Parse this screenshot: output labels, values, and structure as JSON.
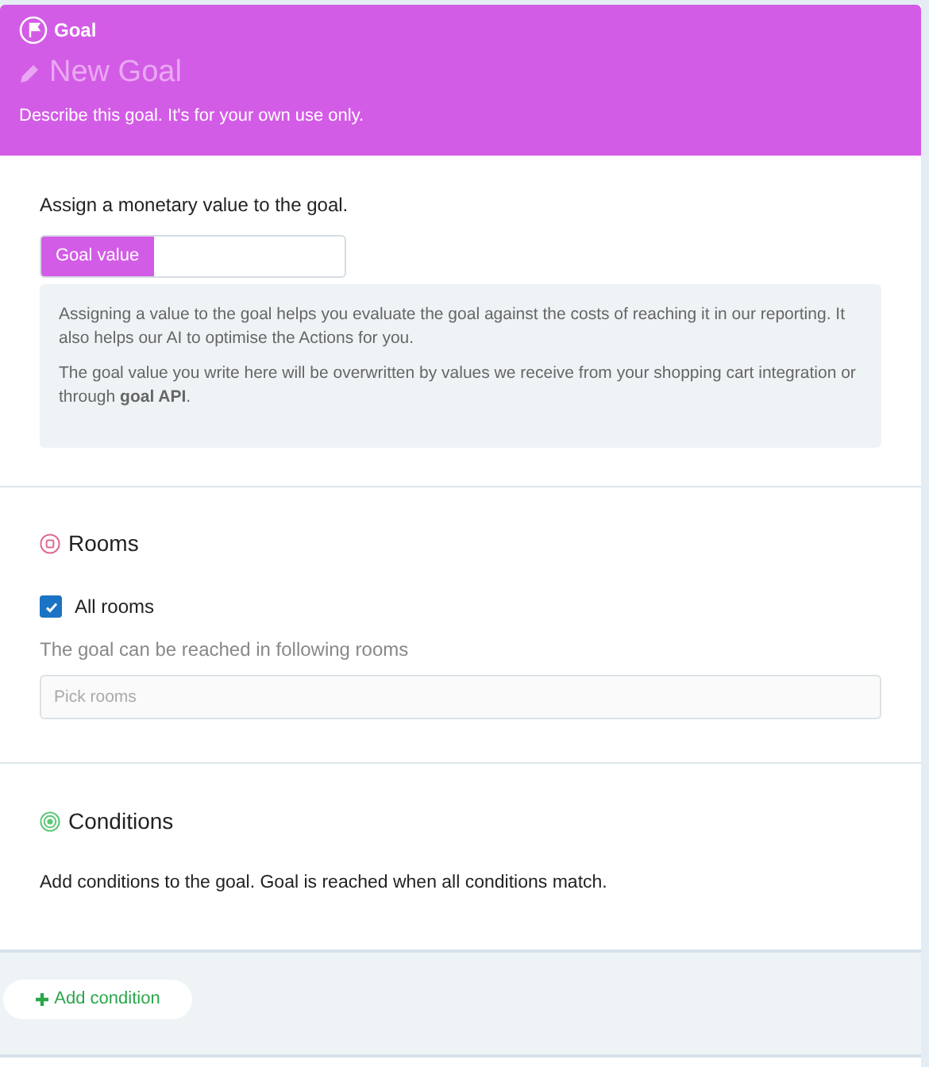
{
  "header": {
    "badge": "Goal",
    "title": "New Goal",
    "description": "Describe this goal. It's for your own use only."
  },
  "value_section": {
    "prompt": "Assign a monetary value to the goal.",
    "field_label": "Goal value",
    "info": [
      "Assigning a value to the goal helps you evaluate the goal against the costs of reaching it in our reporting. It also helps our AI to optimise the Actions for you.",
      "The goal value you write here will be overwritten by values we receive from your shopping cart integration or through **goal API**."
    ]
  },
  "rooms": {
    "title": "Rooms",
    "all_rooms": {
      "label": "All rooms",
      "checked": true
    },
    "hint": "The goal can be reached in following rooms",
    "picker": {
      "placeholder": "Pick rooms"
    }
  },
  "conditions": {
    "title": "Conditions",
    "description": "Add conditions to the goal. Goal is reached when all conditions match.",
    "add_button": "Add condition"
  }
}
